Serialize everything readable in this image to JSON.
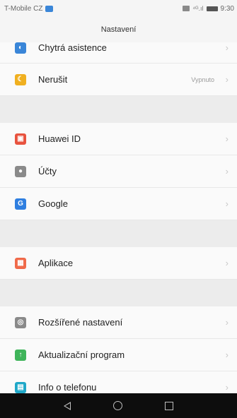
{
  "status_bar": {
    "carrier": "T-Mobile CZ",
    "time": "9:30"
  },
  "title": "Nastavení",
  "sections": [
    {
      "items": [
        {
          "label": "Chytrá asistence",
          "icon": "assistant-icon",
          "color": "#3a86d8",
          "glyph": "◐"
        },
        {
          "label": "Nerušit",
          "value": "Vypnuto",
          "icon": "moon-icon",
          "color": "#f0b020",
          "glyph": "☾"
        }
      ]
    },
    {
      "items": [
        {
          "label": "Huawei ID",
          "icon": "huawei-id-icon",
          "color": "#e8533f",
          "glyph": "▣"
        },
        {
          "label": "Účty",
          "icon": "accounts-icon",
          "color": "#8a8a8a",
          "glyph": "●"
        },
        {
          "label": "Google",
          "icon": "google-icon",
          "color": "#2f7fe0",
          "glyph": "G"
        }
      ]
    },
    {
      "items": [
        {
          "label": "Aplikace",
          "icon": "apps-icon",
          "color": "#f06a4a",
          "glyph": "▦"
        }
      ]
    },
    {
      "items": [
        {
          "label": "Rozšířené nastavení",
          "icon": "advanced-settings-icon",
          "color": "#8a8a8a",
          "glyph": "◎"
        },
        {
          "label": "Aktualizační program",
          "icon": "update-icon",
          "color": "#3fb45a",
          "glyph": "↑"
        },
        {
          "label": "Info o telefonu",
          "icon": "phone-info-icon",
          "color": "#20a8c8",
          "glyph": "▤"
        }
      ]
    }
  ],
  "chevron": "›"
}
